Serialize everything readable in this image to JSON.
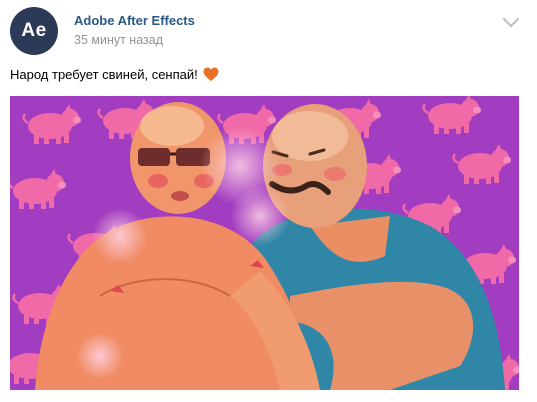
{
  "post": {
    "author": "Adobe After Effects",
    "avatar_text": "Ae",
    "timestamp": "35 минут назад",
    "text": "Народ требует свиней, сенпай!",
    "emoji": "orange-heart-icon"
  },
  "colors": {
    "avatar_bg": "#2b3a57",
    "author_link": "#2a5885",
    "timestamp": "#939393",
    "background_purple": "#a23cc0",
    "pig_pink": "#f06aa8"
  }
}
